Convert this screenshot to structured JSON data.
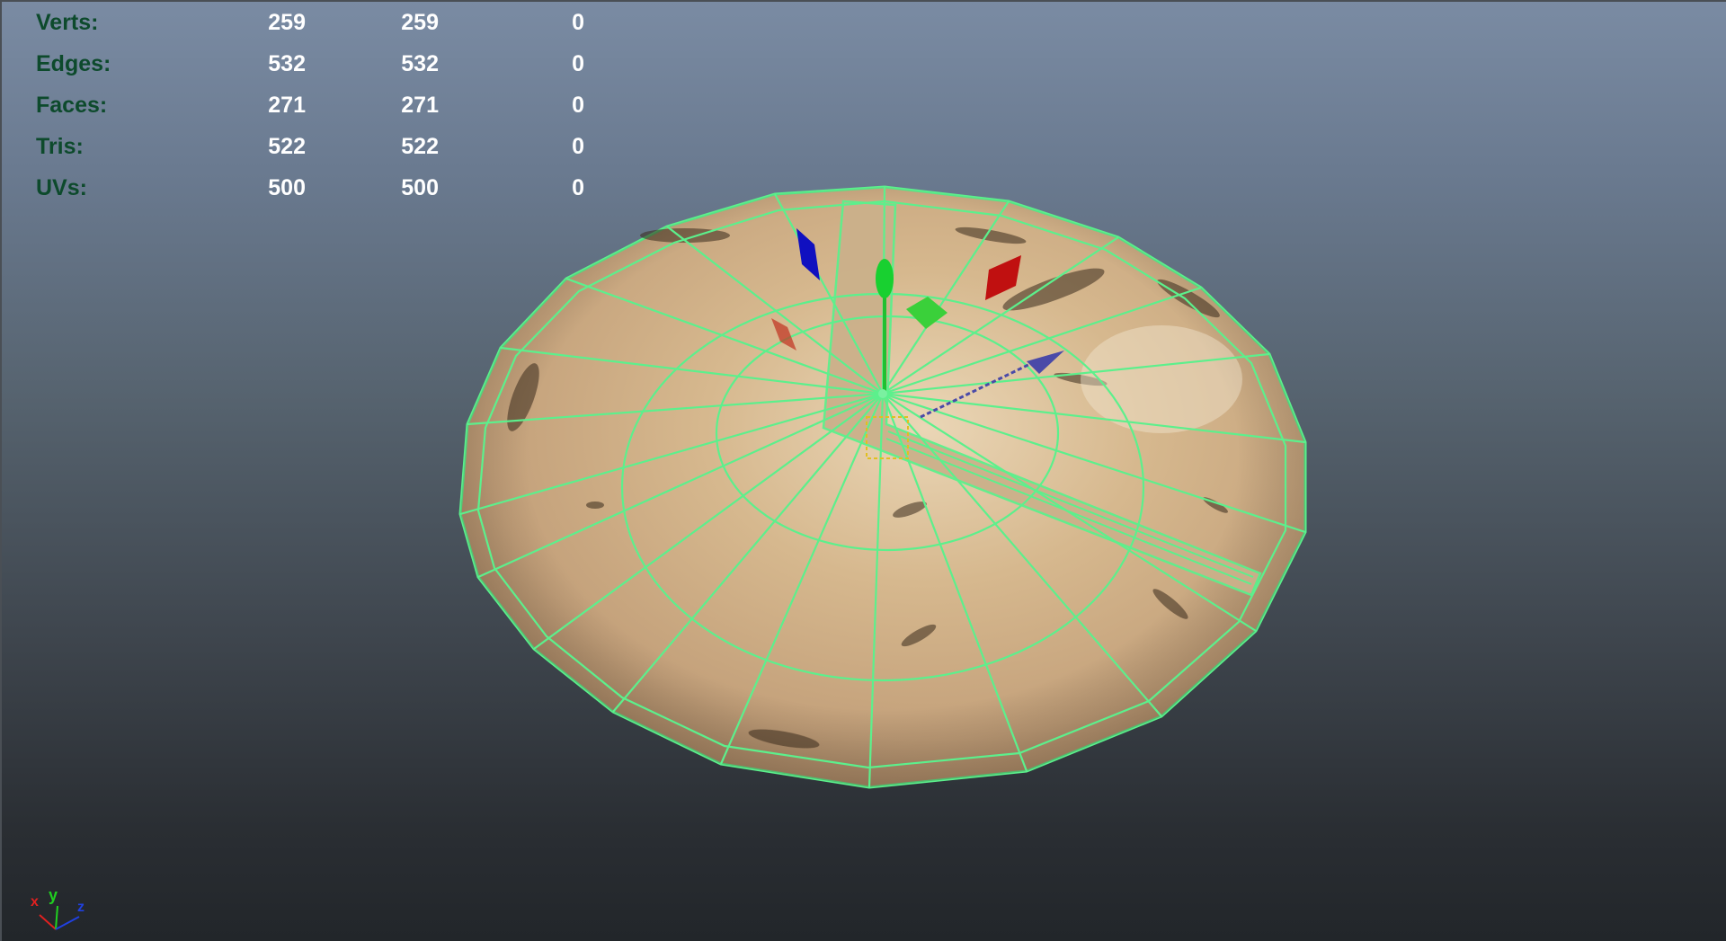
{
  "stats": [
    {
      "label": "Verts:",
      "values": [
        "259",
        "259",
        "0"
      ]
    },
    {
      "label": "Edges:",
      "values": [
        "532",
        "532",
        "0"
      ]
    },
    {
      "label": "Faces:",
      "values": [
        "271",
        "271",
        "0"
      ]
    },
    {
      "label": "Tris:",
      "values": [
        "522",
        "522",
        "0"
      ]
    },
    {
      "label": "UVs:",
      "values": [
        "500",
        "500",
        "0"
      ]
    }
  ],
  "axis": {
    "x": "x",
    "y": "y",
    "z": "z"
  },
  "colors": {
    "wireframe": "#5cf08c",
    "hud_label": "#0d4a2c",
    "hud_value": "#ffffff",
    "axis_x": "#e02020",
    "axis_y": "#20d020",
    "axis_z": "#2040e0"
  }
}
